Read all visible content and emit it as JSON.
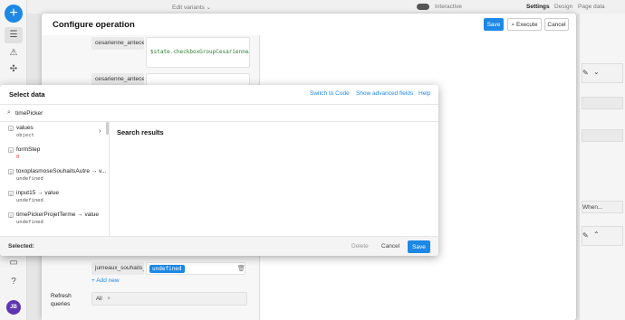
{
  "topbar": {
    "edit_variants": "Edit variants ⌄",
    "interactive": "Interactive",
    "tabs": [
      "Settings",
      "Design",
      "Page data"
    ]
  },
  "configure": {
    "title": "Configure operation",
    "save": "Save",
    "execute": "Execute",
    "cancel": "Cancel",
    "fields": [
      {
        "key": "cesarienne_antecede",
        "value": "$state.checkboxGroupCesarienneAn"
      },
      {
        "key": "cesarienne_antecede",
        "value": ""
      },
      {
        "key": "jumeaux_souhaits_a",
        "value": "undefined"
      }
    ],
    "add_new": "+ Add new",
    "refresh_label": "Refresh queries",
    "refresh_chip": "All",
    "right_button": "When..."
  },
  "select_data": {
    "title": "Select data",
    "switch_to_code": "Switch to Code",
    "show_advanced": "Show advanced fields",
    "help": "Help",
    "search_value": "timePicker",
    "items": [
      {
        "name": "values",
        "value": "object",
        "badge": "{}",
        "arrow": "›"
      },
      {
        "name": "formStep",
        "value": "0",
        "badge": "#"
      },
      {
        "name": "toxoplasmoseSouhaitsAutre → v...",
        "value": "undefined",
        "badge": "{}"
      },
      {
        "name": "input15 → value",
        "value": "undefined",
        "badge": "{}"
      },
      {
        "name": "timePickerProjetTerme → value",
        "value": "undefined",
        "badge": "{}"
      }
    ],
    "results_title": "Search results",
    "selected_label": "Selected:",
    "delete": "Delete",
    "cancel": "Cancel",
    "save": "Save"
  },
  "user": {
    "initials": "JB"
  },
  "icons": [
    "plus-icon",
    "list-icon",
    "warning-icon",
    "components-icon",
    "search-icon",
    "chevron-right-icon",
    "trash-icon",
    "close-icon",
    "comment-icon",
    "help-icon"
  ]
}
